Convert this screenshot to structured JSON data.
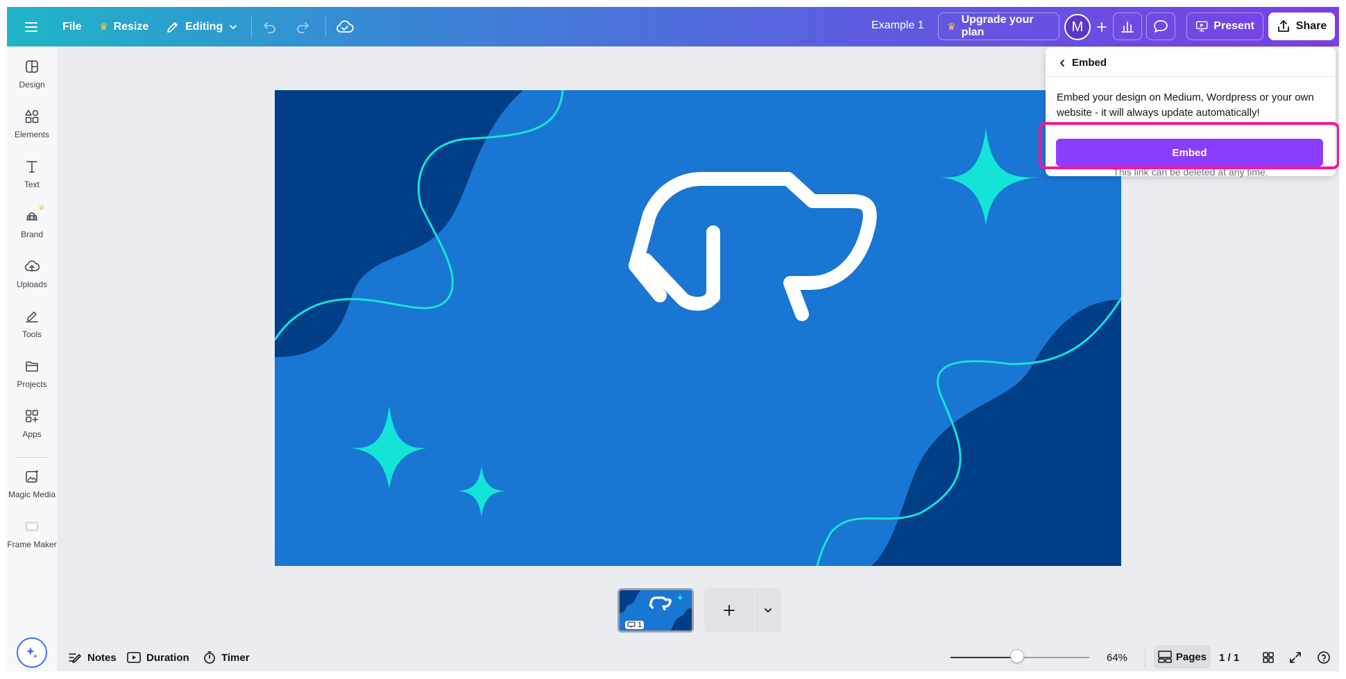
{
  "topbar": {
    "file_label": "File",
    "resize_label": "Resize",
    "editing_label": "Editing",
    "doc_title": "Example 1",
    "upgrade_label": "Upgrade your plan",
    "avatar_initial": "M",
    "present_label": "Present",
    "share_label": "Share",
    "gradient_start": "#1fb4c7",
    "gradient_end": "#7b3fe4"
  },
  "sidebar": {
    "items": [
      {
        "label": "Design",
        "icon": "design-icon"
      },
      {
        "label": "Elements",
        "icon": "elements-icon"
      },
      {
        "label": "Text",
        "icon": "text-icon"
      },
      {
        "label": "Brand",
        "icon": "brand-icon"
      },
      {
        "label": "Uploads",
        "icon": "uploads-icon"
      },
      {
        "label": "Tools",
        "icon": "tools-icon"
      },
      {
        "label": "Projects",
        "icon": "projects-icon"
      },
      {
        "label": "Apps",
        "icon": "apps-icon"
      },
      {
        "label": "Magic Media",
        "icon": "magic-media-icon"
      },
      {
        "label": "Frame Maker",
        "icon": "frame-maker-icon"
      }
    ]
  },
  "embed_popup": {
    "back_label": "Embed",
    "description": "Embed your design on Medium, Wordpress or your own website - it will always update automatically!",
    "button_label": "Embed",
    "note": "This link can be deleted at any time.",
    "button_color": "#8b3dff",
    "highlight_color": "#ff1493"
  },
  "canvas": {
    "background_color": "#1976d2",
    "dark_wave_color": "#003f87",
    "accent_color": "#14e3d8"
  },
  "pages": {
    "thumbnail_number": "1"
  },
  "bottombar": {
    "notes_label": "Notes",
    "duration_label": "Duration",
    "timer_label": "Timer",
    "zoom_label": "64%",
    "zoom_fraction": 0.48,
    "pages_label": "Pages",
    "page_count": "1 / 1"
  }
}
